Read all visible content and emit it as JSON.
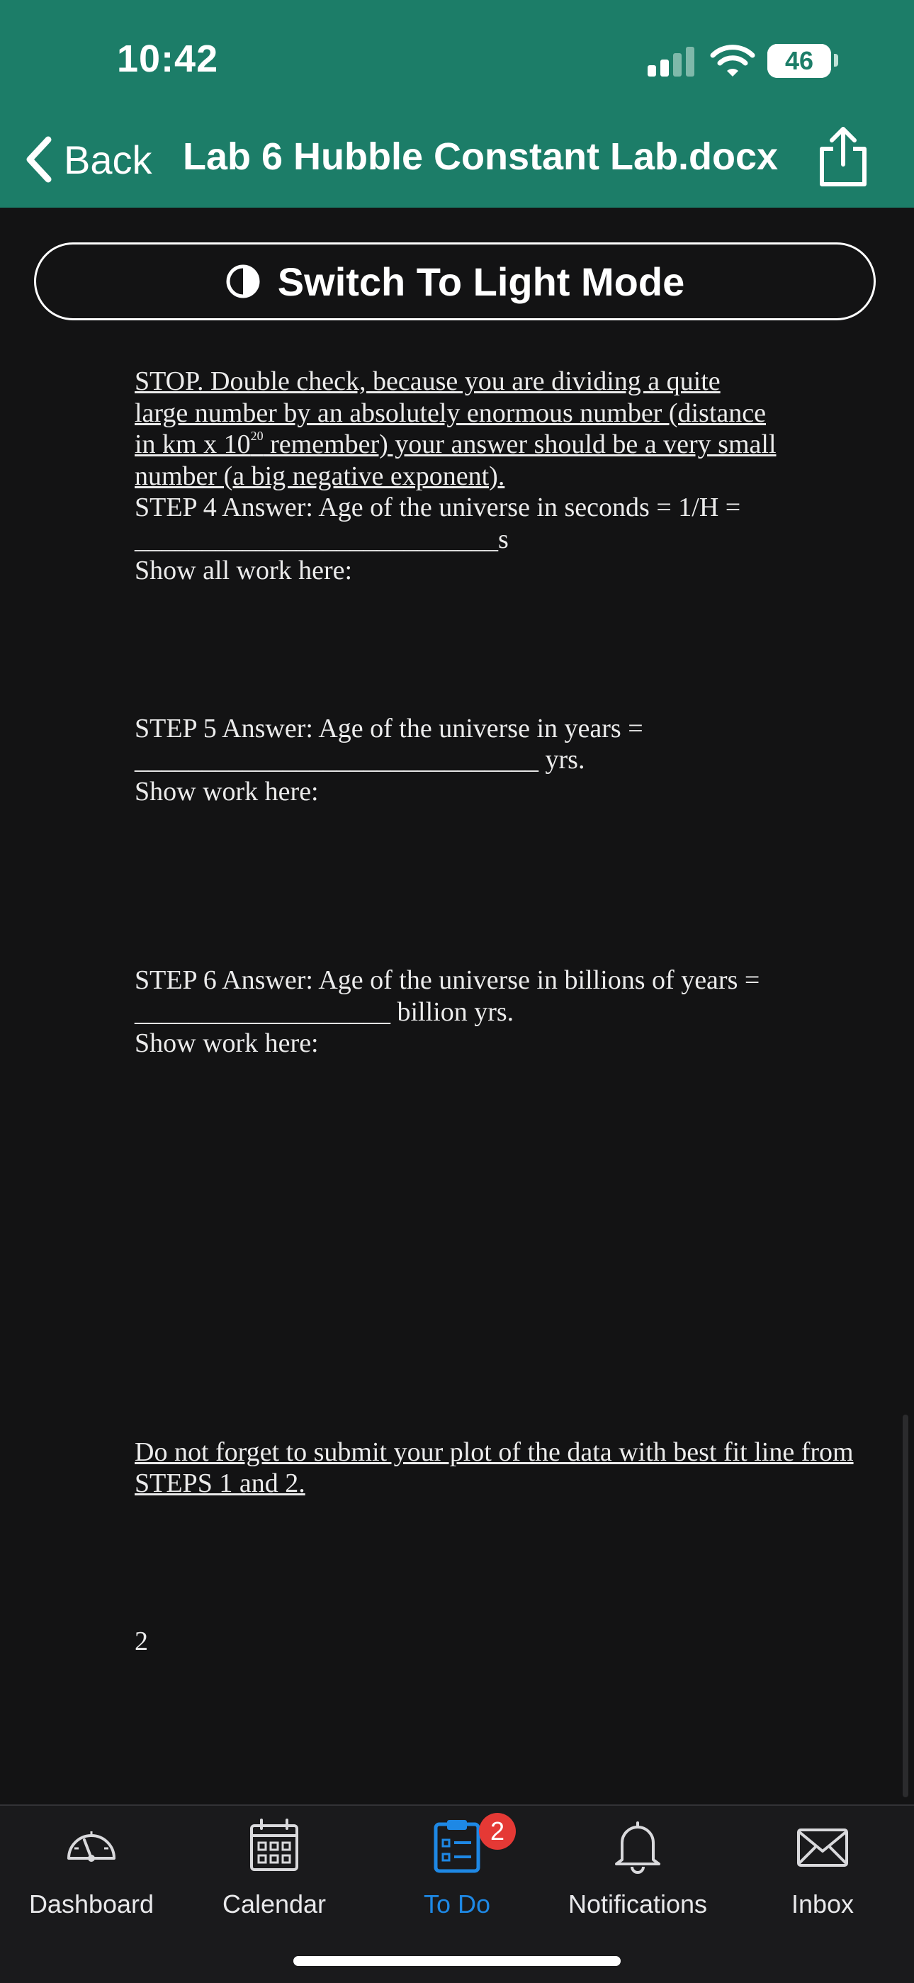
{
  "status_bar": {
    "time": "10:42",
    "battery": "46"
  },
  "nav": {
    "back_label": "Back",
    "title": "Lab 6 Hubble Constant Lab.docx"
  },
  "mode_toggle": {
    "label": "Switch To Light Mode"
  },
  "document": {
    "stop_note": {
      "line1": "STOP.  Double check, because you are dividing a quite",
      "line2": "large number by an absolutely enormous number (distance",
      "line3_pre": "in km x 10",
      "line3_sup": "20",
      "line3_post": " remember) your answer should be a very small",
      "line4": "number (a big negative exponent)."
    },
    "step4": {
      "question": "STEP 4 Answer: Age of the universe in seconds = 1/H =",
      "blank": "___________________________",
      "unit": "s",
      "work": "Show all work here:"
    },
    "step5": {
      "question": "STEP 5 Answer: Age of the universe in years =",
      "blank": "______________________________",
      "unit": " yrs.",
      "work": "Show work here:"
    },
    "step6": {
      "question": "STEP 6 Answer: Age of the universe in billions of years =",
      "blank": "___________________",
      "unit": " billion yrs.",
      "work": "Show work here:"
    },
    "reminder": {
      "line1": "Do not forget to submit your plot of the data with best fit line from",
      "line2": "STEPS 1 and 2."
    },
    "page_number": "2"
  },
  "tabbar": {
    "items": [
      {
        "label": "Dashboard",
        "icon": "dashboard-icon"
      },
      {
        "label": "Calendar",
        "icon": "calendar-icon"
      },
      {
        "label": "To Do",
        "icon": "todo-icon",
        "active": true
      },
      {
        "label": "Notifications",
        "icon": "bell-icon"
      },
      {
        "label": "Inbox",
        "icon": "envelope-icon"
      }
    ],
    "todo_badge": "2",
    "active_color": "#1e88e5"
  },
  "colors": {
    "header": "#1c7d68",
    "background": "#131314"
  }
}
